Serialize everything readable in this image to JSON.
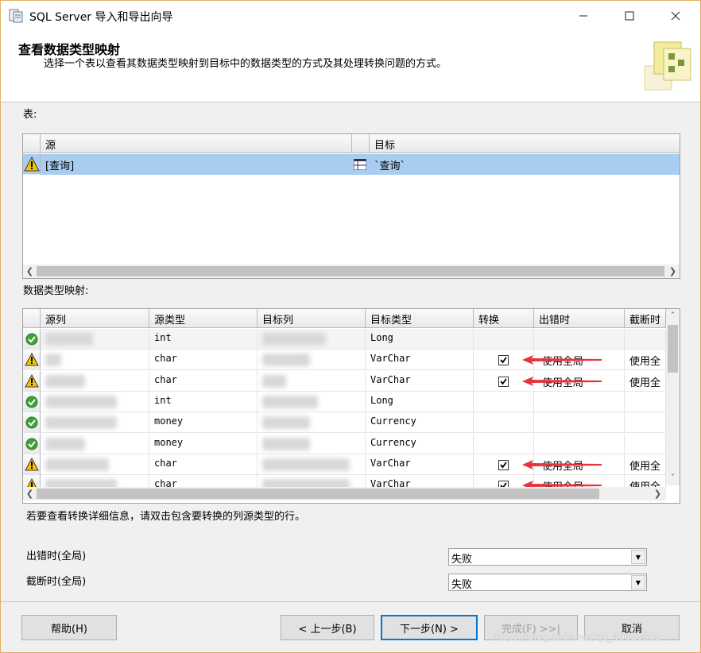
{
  "window": {
    "title": "SQL Server 导入和导出向导"
  },
  "header": {
    "title": "查看数据类型映射",
    "subtitle": "选择一个表以查看其数据类型映射到目标中的数据类型的方式及其处理转换问题的方式。"
  },
  "tables_section": {
    "label": "表:",
    "columns": [
      "源",
      "目标"
    ],
    "rows": [
      {
        "source": "[查询]",
        "target": "`查询`",
        "status": "warning"
      }
    ]
  },
  "mapping_section": {
    "label": "数据类型映射:",
    "columns": [
      "源列",
      "源类型",
      "目标列",
      "目标类型",
      "转换",
      "出错时",
      "截断时"
    ],
    "rows": [
      {
        "status": "ok",
        "src_type": "int",
        "dst_type": "Long",
        "convert": false,
        "on_error": "",
        "on_trunc": ""
      },
      {
        "status": "warning",
        "src_type": "char",
        "dst_type": "VarChar",
        "convert": true,
        "on_error": "使用全局",
        "on_trunc": "使用全"
      },
      {
        "status": "warning",
        "src_type": "char",
        "dst_type": "VarChar",
        "convert": true,
        "on_error": "使用全局",
        "on_trunc": "使用全"
      },
      {
        "status": "ok",
        "src_type": "int",
        "dst_type": "Long",
        "convert": false,
        "on_error": "",
        "on_trunc": ""
      },
      {
        "status": "ok",
        "src_type": "money",
        "dst_type": "Currency",
        "convert": false,
        "on_error": "",
        "on_trunc": ""
      },
      {
        "status": "ok",
        "src_type": "money",
        "dst_type": "Currency",
        "convert": false,
        "on_error": "",
        "on_trunc": ""
      },
      {
        "status": "warning",
        "src_type": "char",
        "dst_type": "VarChar",
        "convert": true,
        "on_error": "使用全局",
        "on_trunc": "使用全"
      },
      {
        "status": "warning",
        "src_type": "char",
        "dst_type": "VarChar",
        "convert": true,
        "on_error": "使用全局",
        "on_trunc": "使用全"
      }
    ]
  },
  "hint": "若要查看转换详细信息，请双击包含要转换的列源类型的行。",
  "global": {
    "on_error_label": "出错时(全局)",
    "on_error_value": "失败",
    "on_trunc_label": "截断时(全局)",
    "on_trunc_value": "失败"
  },
  "buttons": {
    "help": "帮助(H)",
    "back": "< 上一步(B)",
    "next": "下一步(N) >",
    "finish": "完成(F) >>|",
    "cancel": "取消"
  },
  "watermark": "https://blog.csdn.net/qq_40616602",
  "colors": {
    "selection": "#a9cdf0",
    "warning": "#f5c400",
    "ok": "#3aa33a",
    "annotation_arrow": "#e8323c"
  }
}
